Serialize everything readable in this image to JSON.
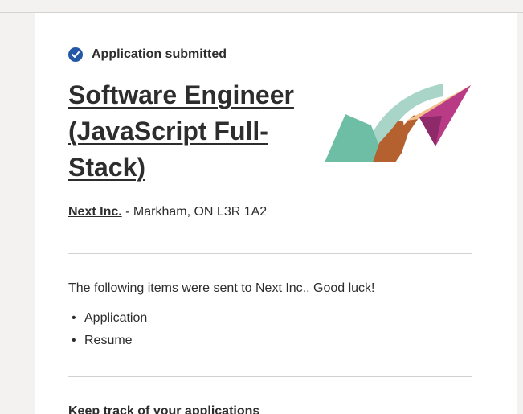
{
  "status": {
    "text": "Application submitted",
    "icon": "check-circle-icon",
    "color": "#2557a7"
  },
  "job": {
    "title": "Software Engineer (JavaScript Full-Stack)",
    "company": "Next Inc.",
    "location": "- Markham, ON L3R 1A2"
  },
  "sent": {
    "message": "The following items were sent to Next Inc.. Good luck!",
    "items": [
      "Application",
      "Resume"
    ]
  },
  "track": {
    "heading": "Keep track of your applications"
  },
  "illustration": {
    "icon": "paper-plane-hand-icon"
  }
}
